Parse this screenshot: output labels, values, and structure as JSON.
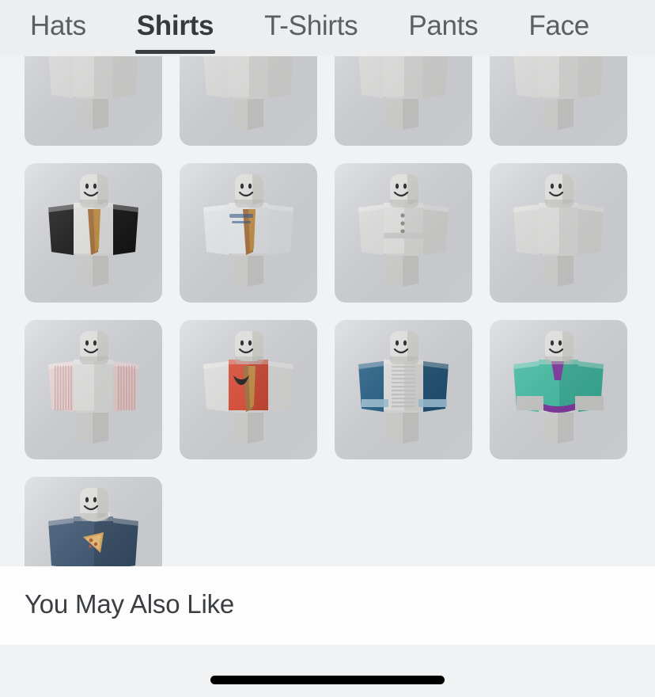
{
  "screen": {
    "background_color": "#f1f2f4",
    "card_color": "#d6d8dc",
    "accent_color": "#393c41"
  },
  "tabbar": {
    "background_color": "#eceef0",
    "active_tab": "Shirts",
    "tabs": [
      {
        "label": "Hats",
        "active": false
      },
      {
        "label": "Shirts",
        "active": true
      },
      {
        "label": "T-Shirts",
        "active": false
      },
      {
        "label": "Pants",
        "active": false
      },
      {
        "label": "Face",
        "active": false
      }
    ]
  },
  "catalog": {
    "section_name": "Shirts",
    "items": [
      {
        "id": "row0-c0",
        "name": "clipped-item-1",
        "clipped": true,
        "style": "plain-white"
      },
      {
        "id": "row0-c1",
        "name": "clipped-item-2",
        "clipped": true,
        "style": "plain-white"
      },
      {
        "id": "row0-c2",
        "name": "clipped-item-3",
        "clipped": true,
        "style": "plain-white"
      },
      {
        "id": "row0-c3",
        "name": "clipped-item-4",
        "clipped": true,
        "style": "plain-white"
      },
      {
        "id": "row1-c0",
        "name": "black-sleeve-shirt-with-brown-hair",
        "clipped": false,
        "style": "black-sleeves"
      },
      {
        "id": "row1-c1",
        "name": "white-graphic-shirt-with-brown-hair",
        "clipped": false,
        "style": "white-graphic"
      },
      {
        "id": "row1-c2",
        "name": "white-shirt-with-buttons",
        "clipped": false,
        "style": "white-buttons"
      },
      {
        "id": "row1-c3",
        "name": "plain-white-shirt",
        "clipped": false,
        "style": "plain-white"
      },
      {
        "id": "row2-c0",
        "name": "pink-striped-sleeve-shirt",
        "clipped": false,
        "style": "pink-stripes"
      },
      {
        "id": "row2-c1",
        "name": "red-top-with-brown-hair",
        "clipped": false,
        "style": "red-top"
      },
      {
        "id": "row2-c2",
        "name": "blue-denim-jacket-with-white-shirt",
        "clipped": false,
        "style": "denim-jacket"
      },
      {
        "id": "row2-c3",
        "name": "teal-sweater-with-purple-trim",
        "clipped": false,
        "style": "teal-sweater"
      },
      {
        "id": "row3-c0",
        "name": "navy-shirt-with-pizza-graphic",
        "clipped": false,
        "style": "navy-pizza"
      }
    ]
  },
  "recommendations": {
    "title": "You May Also Like"
  },
  "system": {
    "home_indicator": "home-indicator-bar"
  }
}
